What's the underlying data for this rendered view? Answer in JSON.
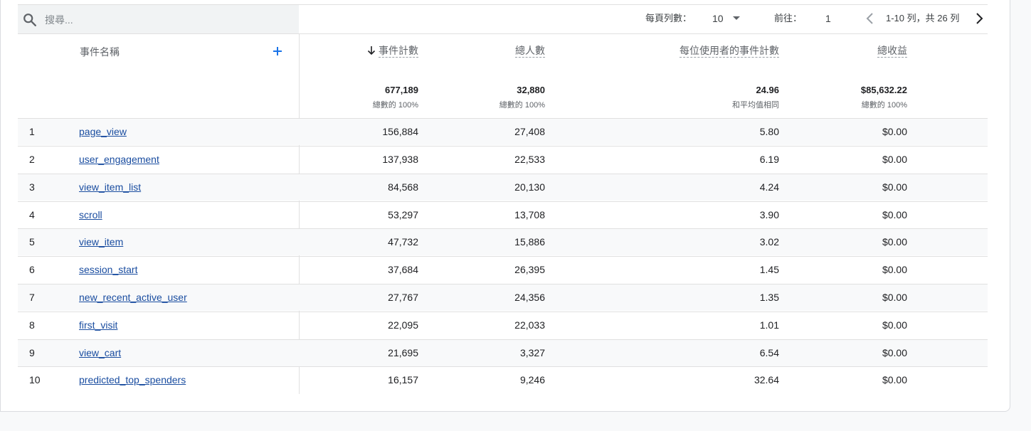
{
  "search": {
    "placeholder": "搜尋..."
  },
  "pagination": {
    "rows_per_page_label": "每頁列數：",
    "rows_per_page_value": "10",
    "goto_label": "前往：",
    "goto_value": "1",
    "range_text": "1-10 列，共 26 列"
  },
  "columns": {
    "event_name": "事件名稱",
    "event_count": "事件計數",
    "total_users": "總人數",
    "events_per_user": "每位使用者的事件計數",
    "total_revenue": "總收益"
  },
  "totals": {
    "event_count": {
      "value": "677,189",
      "sub": "總數的 100%"
    },
    "total_users": {
      "value": "32,880",
      "sub": "總數的 100%"
    },
    "events_per_user": {
      "value": "24.96",
      "sub": "和平均值相同"
    },
    "total_revenue": {
      "value": "$85,632.22",
      "sub": "總數的 100%"
    }
  },
  "rows": [
    {
      "index": "1",
      "name": "page_view",
      "event_count": "156,884",
      "total_users": "27,408",
      "events_per_user": "5.80",
      "total_revenue": "$0.00"
    },
    {
      "index": "2",
      "name": "user_engagement",
      "event_count": "137,938",
      "total_users": "22,533",
      "events_per_user": "6.19",
      "total_revenue": "$0.00"
    },
    {
      "index": "3",
      "name": "view_item_list",
      "event_count": "84,568",
      "total_users": "20,130",
      "events_per_user": "4.24",
      "total_revenue": "$0.00"
    },
    {
      "index": "4",
      "name": "scroll",
      "event_count": "53,297",
      "total_users": "13,708",
      "events_per_user": "3.90",
      "total_revenue": "$0.00"
    },
    {
      "index": "5",
      "name": "view_item",
      "event_count": "47,732",
      "total_users": "15,886",
      "events_per_user": "3.02",
      "total_revenue": "$0.00"
    },
    {
      "index": "6",
      "name": "session_start",
      "event_count": "37,684",
      "total_users": "26,395",
      "events_per_user": "1.45",
      "total_revenue": "$0.00"
    },
    {
      "index": "7",
      "name": "new_recent_active_user",
      "event_count": "27,767",
      "total_users": "24,356",
      "events_per_user": "1.35",
      "total_revenue": "$0.00"
    },
    {
      "index": "8",
      "name": "first_visit",
      "event_count": "22,095",
      "total_users": "22,033",
      "events_per_user": "1.01",
      "total_revenue": "$0.00"
    },
    {
      "index": "9",
      "name": "view_cart",
      "event_count": "21,695",
      "total_users": "3,327",
      "events_per_user": "6.54",
      "total_revenue": "$0.00"
    },
    {
      "index": "10",
      "name": "predicted_top_spenders",
      "event_count": "16,157",
      "total_users": "9,246",
      "events_per_user": "32.64",
      "total_revenue": "$0.00"
    }
  ],
  "icons": {
    "search": "search-icon",
    "dropdown": "caret-down-icon",
    "prev": "chevron-left-icon",
    "next": "chevron-right-icon",
    "add": "plus-icon",
    "sort": "arrow-down-icon"
  },
  "colors": {
    "link": "#1a4da0",
    "accent": "#1a73e8"
  }
}
